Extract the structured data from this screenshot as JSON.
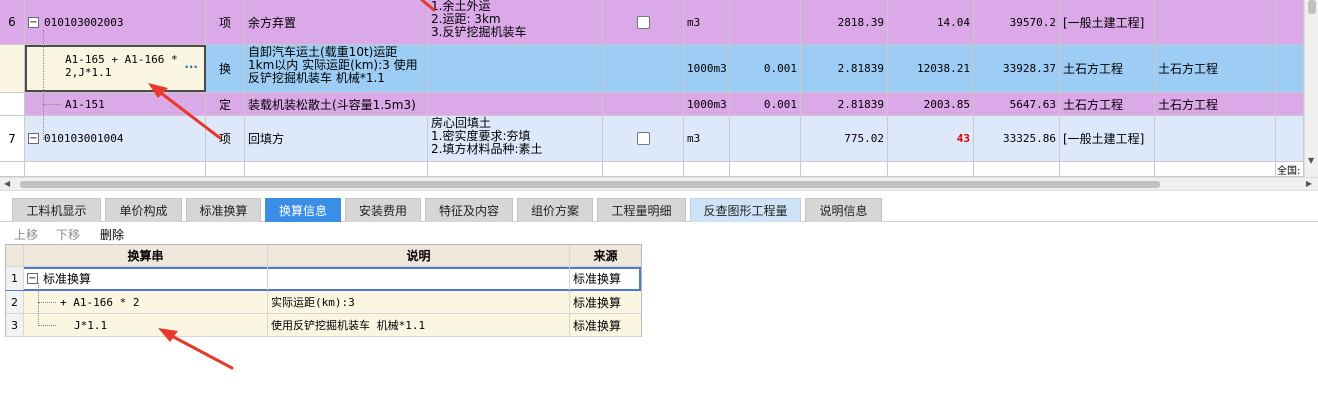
{
  "upper_rows": [
    {
      "num": "6",
      "code": "010103002003",
      "type": "项",
      "name": "余方弃置",
      "features": [
        "1.余土外运",
        "2.运距: 3km",
        "3.反铲挖掘机装车"
      ],
      "unit": "m3",
      "qty_ratio": "",
      "quantity": "2818.39",
      "unit_price": "14.04",
      "total": "39570.2",
      "category": "[一般土建工程]",
      "category2": ""
    },
    {
      "num": "",
      "code": "A1-165 + A1-166 * 2,J*1.1",
      "type": "换",
      "name": "自卸汽车运土(载重10t)运距 1km以内  实际运距(km):3  使用反铲挖掘机装车 机械*1.1",
      "features": [],
      "unit": "1000m3",
      "qty_ratio": "0.001",
      "quantity": "2.81839",
      "unit_price": "12038.21",
      "total": "33928.37",
      "category": "土石方工程",
      "category2": "土石方工程",
      "edit_button": "···"
    },
    {
      "num": "",
      "code": "A1-151",
      "type": "定",
      "name": "装载机装松散土(斗容量1.5m3)",
      "features": [],
      "unit": "1000m3",
      "qty_ratio": "0.001",
      "quantity": "2.81839",
      "unit_price": "2003.85",
      "total": "5647.63",
      "category": "土石方工程",
      "category2": "土石方工程"
    },
    {
      "num": "7",
      "code": "010103001004",
      "type": "项",
      "name": "回填方",
      "features": [
        "房心回填土",
        "1.密实度要求:夯填",
        "2.填方材料品种:素土"
      ],
      "unit": "m3",
      "qty_ratio": "",
      "quantity": "775.02",
      "unit_price": "43",
      "total": "33325.86",
      "category": "[一般土建工程]",
      "category2": ""
    }
  ],
  "overflow_text": "全国:",
  "tabs": [
    {
      "label": "工料机显示"
    },
    {
      "label": "单价构成"
    },
    {
      "label": "标准换算"
    },
    {
      "label": "换算信息"
    },
    {
      "label": "安装费用"
    },
    {
      "label": "特征及内容"
    },
    {
      "label": "组价方案"
    },
    {
      "label": "工程量明细"
    },
    {
      "label": "反查图形工程量"
    },
    {
      "label": "说明信息"
    }
  ],
  "toolbar": {
    "move_up": "上移",
    "move_down": "下移",
    "delete": "删除"
  },
  "lower_grid": {
    "headers": [
      "换算串",
      "说明",
      "来源"
    ],
    "rows": [
      {
        "num": "1",
        "string": "标准换算",
        "desc": "",
        "source": "标准换算"
      },
      {
        "num": "2",
        "string": "+ A1-166 * 2",
        "desc": "实际运距(km):3",
        "source": "标准换算"
      },
      {
        "num": "3",
        "string": "J*1.1",
        "desc": "使用反铲挖掘机装车 机械*1.1",
        "source": "标准换算"
      }
    ]
  },
  "colors": {
    "row_purple": "#dba8e8",
    "row_blue": "#9dcdf5",
    "row_light_blue": "#dde9fb",
    "active_tab": "#3b8ee5",
    "arrow": "#e8392b"
  }
}
